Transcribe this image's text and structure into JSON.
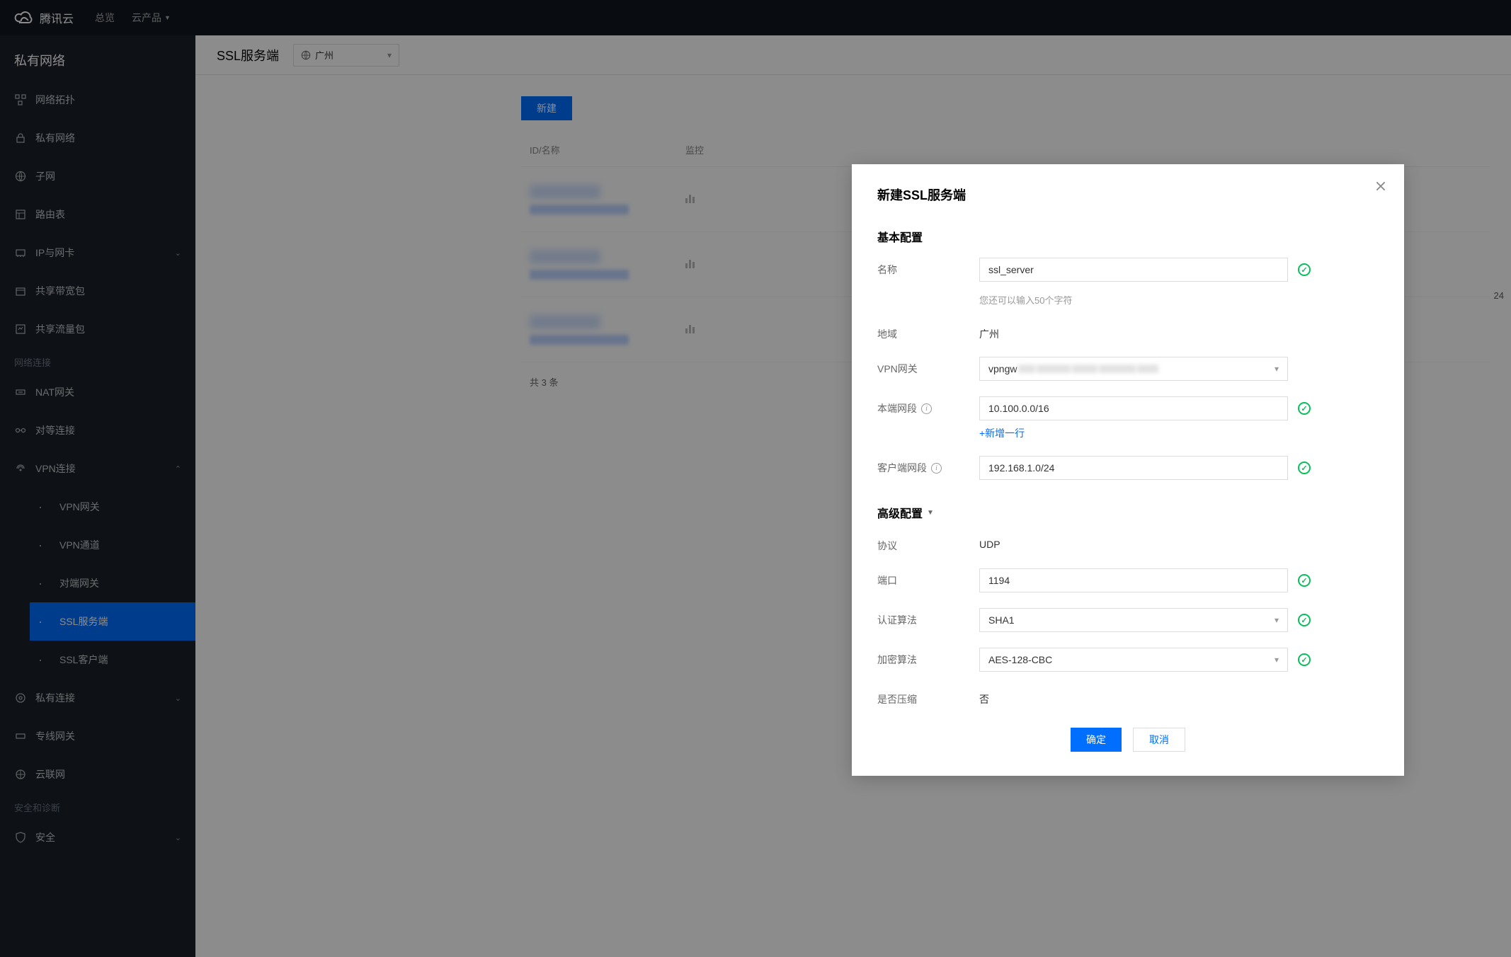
{
  "header": {
    "brand": "腾讯云",
    "nav_overview": "总览",
    "nav_products": "云产品"
  },
  "sidebar": {
    "title": "私有网络",
    "items": {
      "topology": "网络拓扑",
      "vpc": "私有网络",
      "subnet": "子网",
      "route": "路由表",
      "ip_nic": "IP与网卡",
      "bw_pkg": "共享带宽包",
      "flow_pkg": "共享流量包"
    },
    "group_netconn": "网络连接",
    "netconn": {
      "nat": "NAT网关",
      "peering": "对等连接",
      "vpn": "VPN连接",
      "vpn_gw": "VPN网关",
      "vpn_tunnel": "VPN通道",
      "peer_gw": "对端网关",
      "ssl_server": "SSL服务端",
      "ssl_client": "SSL客户端"
    },
    "private_link": "私有连接",
    "direct_gw": "专线网关",
    "cloud_conn": "云联网",
    "group_safety": "安全和诊断",
    "safety": "安全"
  },
  "main": {
    "title": "SSL服务端",
    "region": "广州",
    "new_btn": "新建",
    "col_id_name": "ID/名称",
    "col_monitor": "监控",
    "pager": "共 3 条",
    "cidr_suffix": "24"
  },
  "modal": {
    "title": "新建SSL服务端",
    "section_basic": "基本配置",
    "section_advanced": "高级配置",
    "labels": {
      "name": "名称",
      "region": "地域",
      "vpn_gw": "VPN网关",
      "local_cidr": "本端网段",
      "client_cidr": "客户端网段",
      "protocol": "协议",
      "port": "端口",
      "auth_alg": "认证算法",
      "enc_alg": "加密算法",
      "compress": "是否压缩"
    },
    "values": {
      "name": "ssl_server",
      "name_hint": "您还可以输入50个字符",
      "region": "广州",
      "vpn_gw_prefix": "vpngw",
      "local_cidr": "10.100.0.0/16",
      "add_line": "+新增一行",
      "client_cidr": "192.168.1.0/24",
      "protocol": "UDP",
      "port": "1194",
      "auth_alg": "SHA1",
      "enc_alg": "AES-128-CBC",
      "compress": "否"
    },
    "btn_ok": "确定",
    "btn_cancel": "取消"
  }
}
